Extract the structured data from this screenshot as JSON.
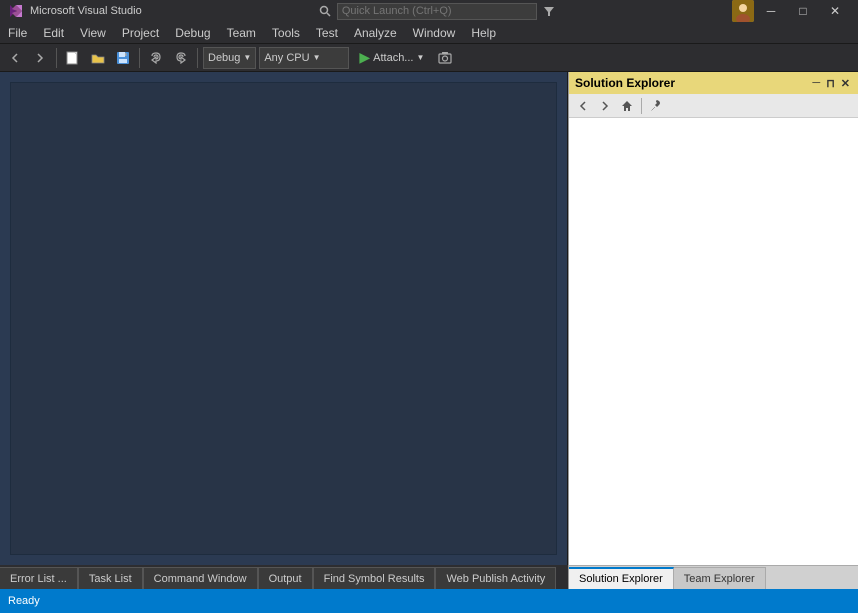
{
  "title_bar": {
    "title": "Microsoft Visual Studio",
    "minimize_label": "─",
    "restore_label": "□",
    "close_label": "✕",
    "quick_launch_placeholder": "Quick Launch (Ctrl+Q)"
  },
  "menu": {
    "items": [
      "File",
      "Edit",
      "View",
      "Project",
      "Debug",
      "Team",
      "Tools",
      "Test",
      "Analyze",
      "Window",
      "Help"
    ]
  },
  "toolbar": {
    "debug_config": "Debug",
    "platform": "Any CPU",
    "attach_label": "Attach...",
    "back_tooltip": "Navigate Backward",
    "forward_tooltip": "Navigate Forward"
  },
  "solution_explorer": {
    "title": "Solution Explorer",
    "pin_label": "⊓",
    "close_label": "✕",
    "auto_hide_label": "─"
  },
  "bottom_tabs": {
    "tabs": [
      {
        "label": "Error List ...",
        "active": false
      },
      {
        "label": "Task List",
        "active": false
      },
      {
        "label": "Command Window",
        "active": false
      },
      {
        "label": "Output",
        "active": false
      },
      {
        "label": "Find Symbol Results",
        "active": false
      },
      {
        "label": "Web Publish Activity",
        "active": false
      }
    ]
  },
  "se_bottom_tabs": {
    "tabs": [
      {
        "label": "Solution Explorer",
        "active": true
      },
      {
        "label": "Team Explorer",
        "active": false
      }
    ]
  },
  "status_bar": {
    "status": "Ready"
  }
}
